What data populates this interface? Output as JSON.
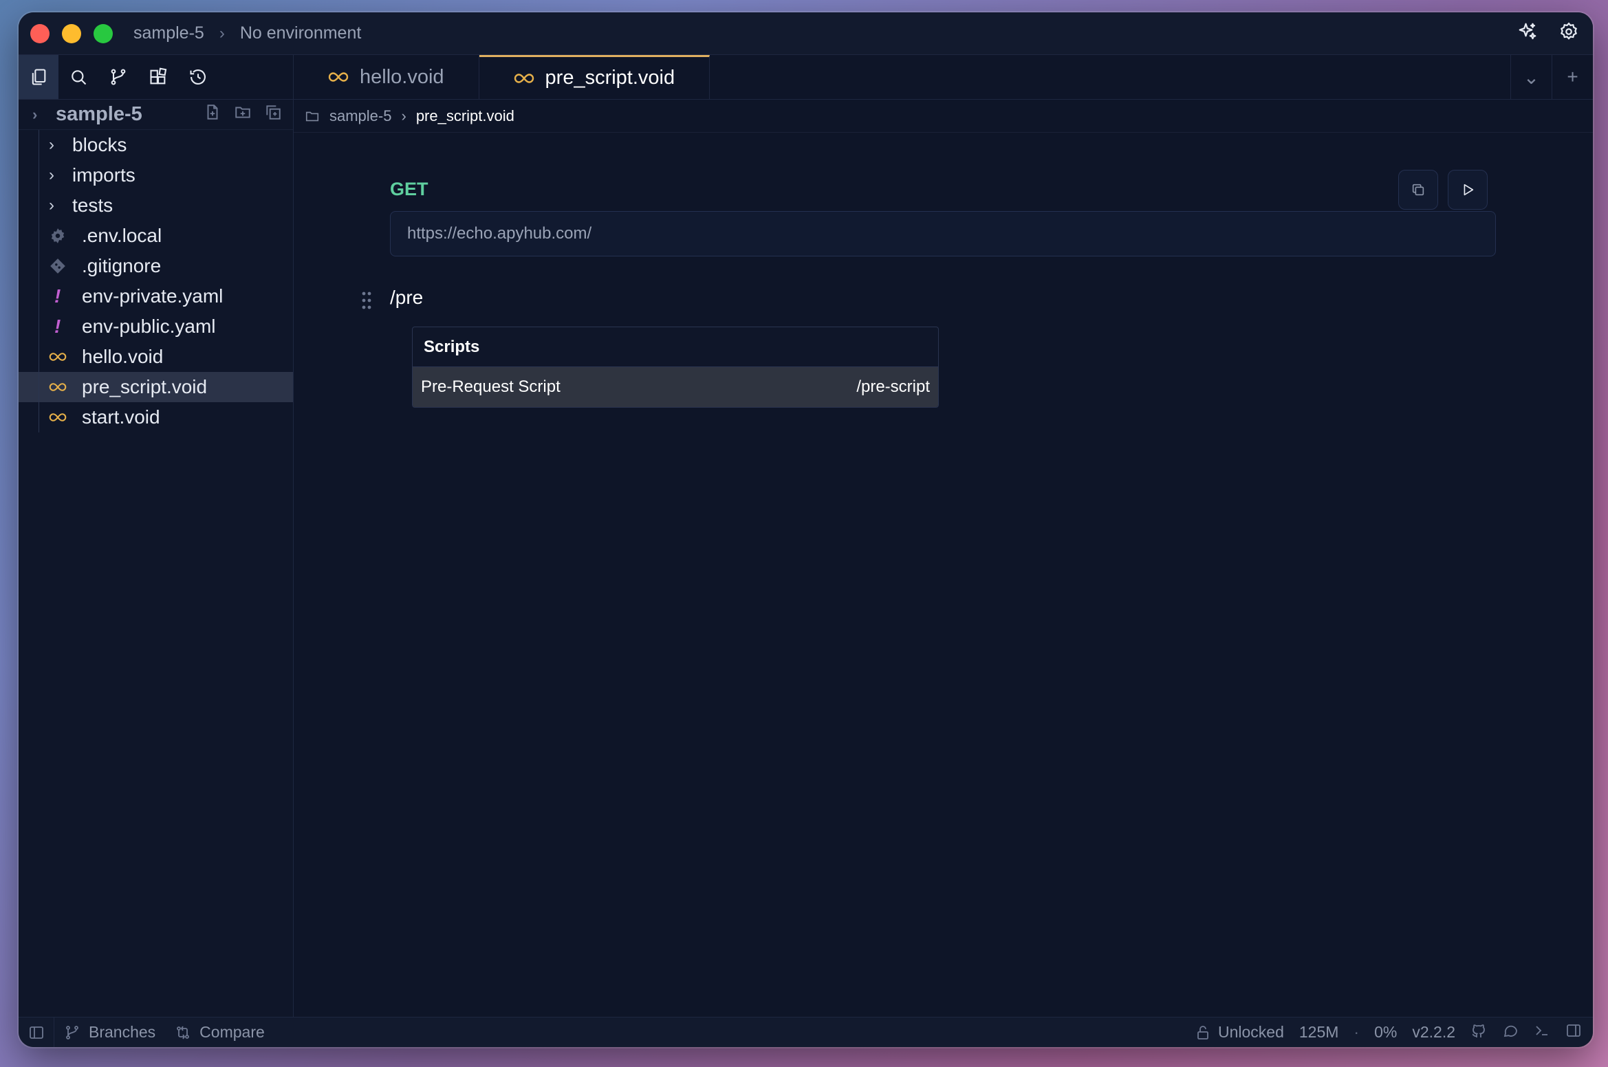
{
  "window": {
    "project": "sample-5",
    "environment": "No environment"
  },
  "tabs": [
    {
      "label": "hello.void",
      "active": false
    },
    {
      "label": "pre_script.void",
      "active": true
    }
  ],
  "sidebar": {
    "root": "sample-5",
    "items": [
      {
        "label": "blocks",
        "type": "folder"
      },
      {
        "label": "imports",
        "type": "folder"
      },
      {
        "label": "tests",
        "type": "folder"
      },
      {
        "label": ".env.local",
        "type": "gear"
      },
      {
        "label": ".gitignore",
        "type": "git"
      },
      {
        "label": "env-private.yaml",
        "type": "yaml"
      },
      {
        "label": "env-public.yaml",
        "type": "yaml"
      },
      {
        "label": "hello.void",
        "type": "void"
      },
      {
        "label": "pre_script.void",
        "type": "void",
        "selected": true
      },
      {
        "label": "start.void",
        "type": "void"
      }
    ]
  },
  "breadcrumb": {
    "folder": "sample-5",
    "file": "pre_script.void"
  },
  "request": {
    "method": "GET",
    "url": "https://echo.apyhub.com/"
  },
  "editor": {
    "slash_text": "/pre"
  },
  "slash_menu": {
    "header": "Scripts",
    "item_label": "Pre-Request Script",
    "item_command": "/pre-script"
  },
  "statusbar": {
    "branches": "Branches",
    "compare": "Compare",
    "lock": "Unlocked",
    "memory": "125M",
    "cpu": "0%",
    "version": "v2.2.2"
  },
  "colors": {
    "accent_tab": "#e0b060",
    "method_get": "#5fcf9f",
    "yaml_icon": "#c25fd1",
    "void_icon": "#e6b04a"
  }
}
